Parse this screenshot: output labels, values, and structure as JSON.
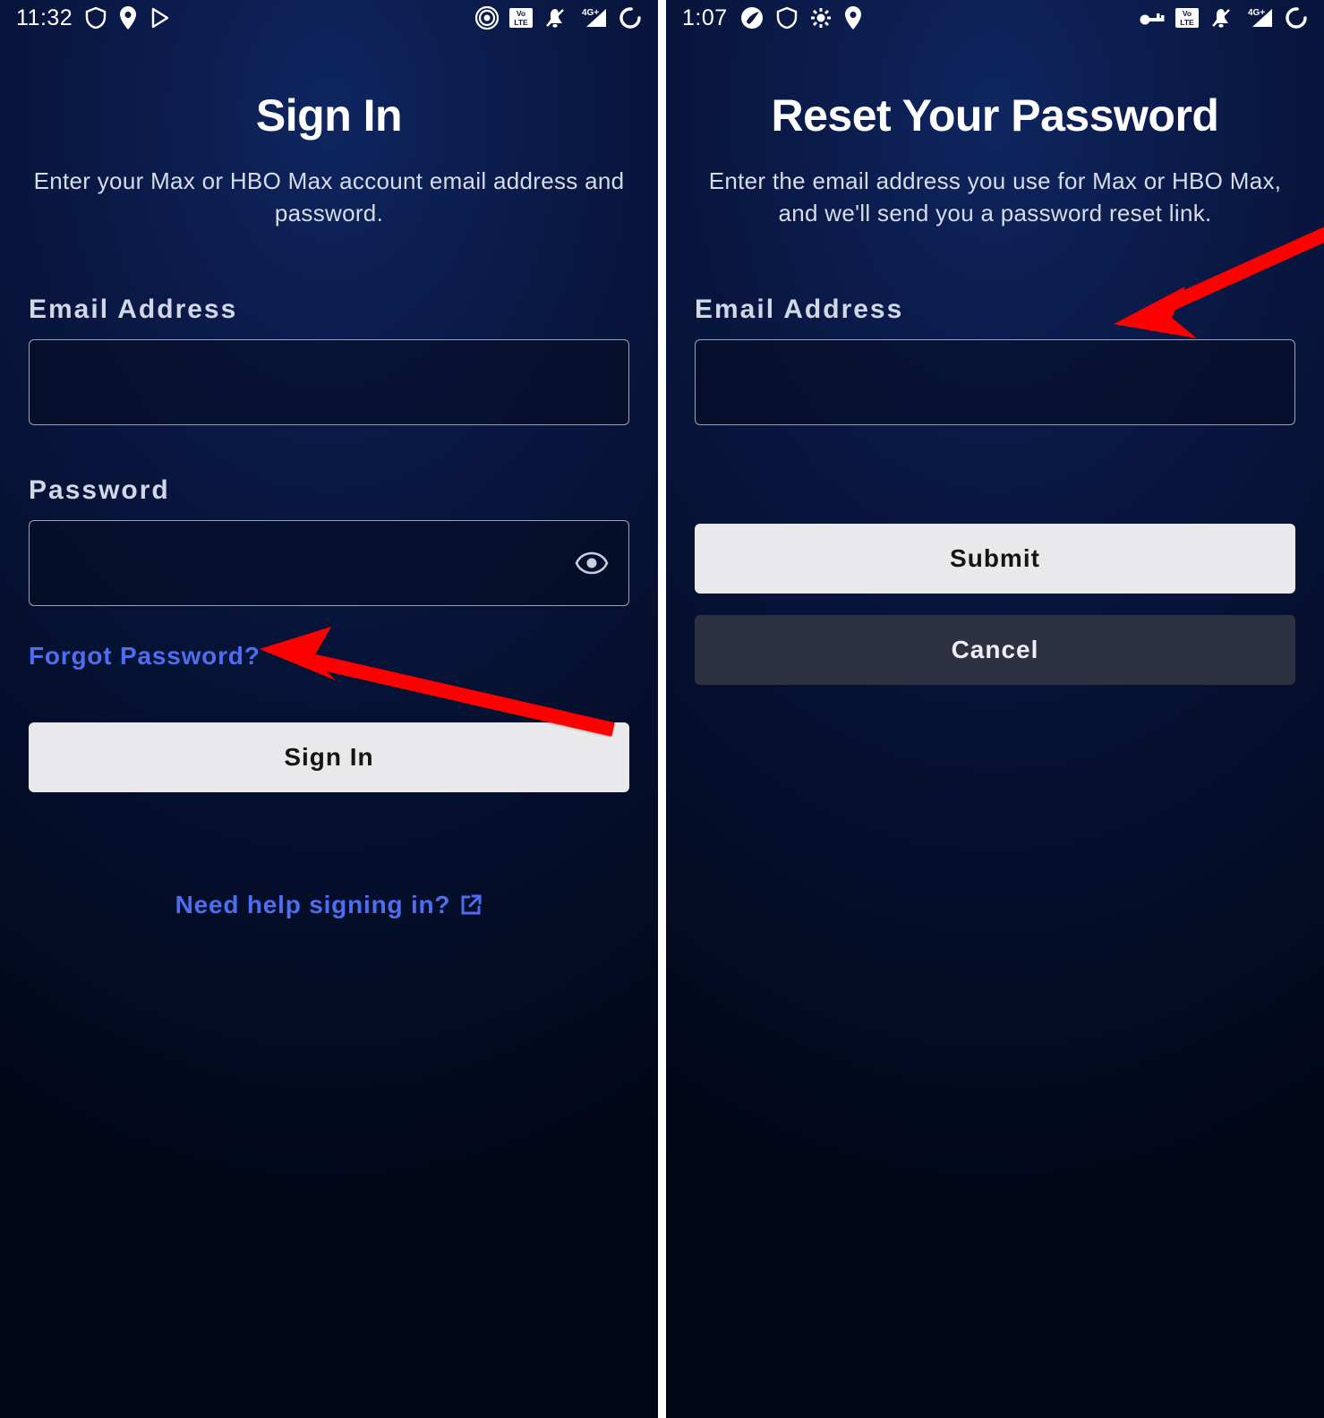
{
  "left": {
    "status": {
      "time": "11:32"
    },
    "title": "Sign In",
    "subtitle": "Enter your Max or HBO Max account email address and password.",
    "email_label": "Email Address",
    "password_label": "Password",
    "forgot_link": "Forgot Password?",
    "signin_button": "Sign In",
    "help_link": "Need help signing in?"
  },
  "right": {
    "status": {
      "time": "1:07"
    },
    "title": "Reset Your Password",
    "subtitle": "Enter the email address you use for Max or HBO Max, and we'll send you a password reset link.",
    "email_label": "Email Address",
    "submit_button": "Submit",
    "cancel_button": "Cancel"
  }
}
